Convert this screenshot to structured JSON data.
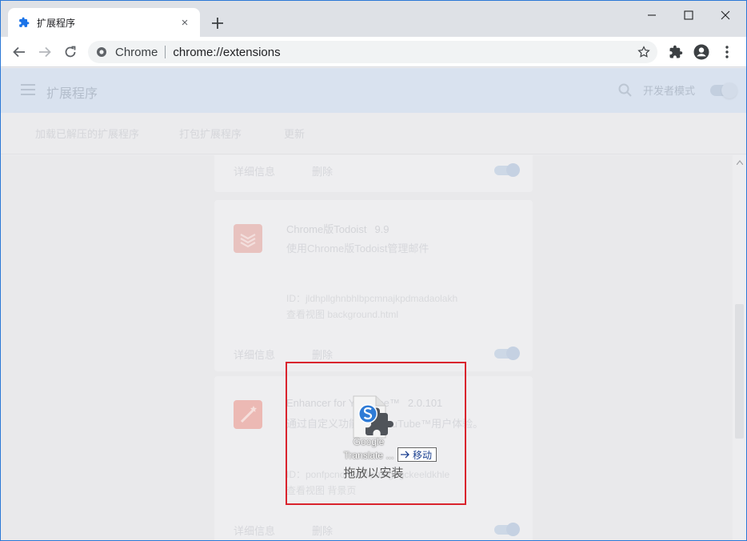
{
  "browser": {
    "tab": {
      "title": "扩展程序",
      "favicon": "puzzle-icon",
      "close": "×"
    },
    "new_tab": "+",
    "omnibox": {
      "site_label": "Chrome",
      "url": "chrome://extensions"
    },
    "accent_color": "#1a73e8"
  },
  "page": {
    "header_title": "扩展程序",
    "developer_mode_label": "开发者模式",
    "toolbar_buttons": [
      "加载已解压的扩展程序",
      "打包扩展程序",
      "更新"
    ]
  },
  "extensions": [
    {
      "details_label": "详细信息",
      "remove_label": "删除",
      "enabled": true
    },
    {
      "name": "Chrome版Todoist",
      "version": "9.9",
      "description": "使用Chrome版Todoist管理邮件",
      "id_line": "ID：jldhpllghnbhlbpcmnajkpdmadaolakh",
      "view_line": "查看视图 background.html",
      "details_label": "详细信息",
      "remove_label": "删除",
      "enabled": true,
      "icon_color": "#e8c2bf"
    },
    {
      "name": "Enhancer for YouTube™",
      "version": "2.0.101",
      "description": "通过自定义功能增强YouTube™用户体验。",
      "id_line": "ID：ponfpcnoihfmfllpaingbgckeeldkhle",
      "view_line": "查看视图 背景页",
      "details_label": "详细信息",
      "remove_label": "删除",
      "enabled": true,
      "icon_color": "#ecb9b4"
    }
  ],
  "drag_overlay": {
    "file_name_line1": "Google",
    "file_name_line2": "Translate ...",
    "move_label": "移动",
    "drop_text": "拖放以安装",
    "frame_color": "#d9232d"
  }
}
